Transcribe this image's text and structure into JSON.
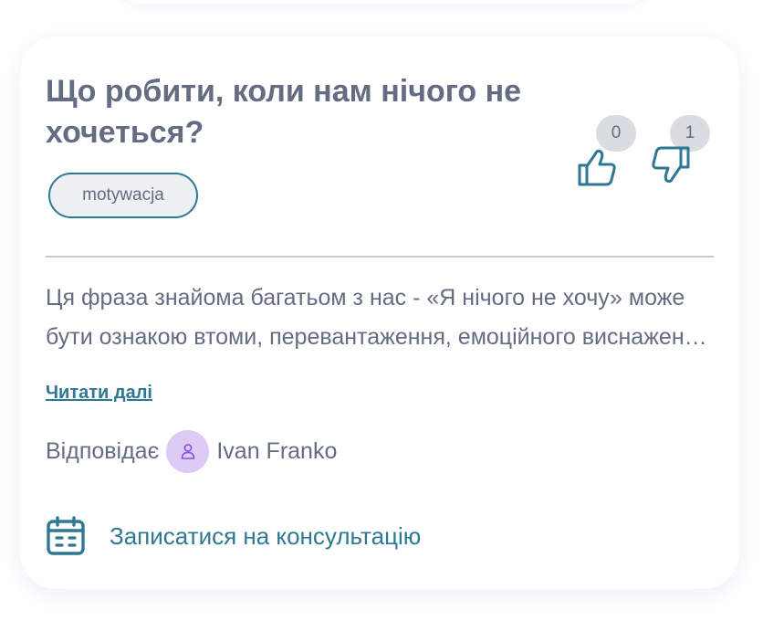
{
  "card": {
    "title": "Що робити, коли нам нічого не хочеться?",
    "tag": "motywacja",
    "likes": "0",
    "dislikes": "1",
    "excerpt": "Ця фраза знайома багатьом з нас - «Я нічого не хочу» може бути ознакою втоми, перевантаження, емоційного виснаження або навіть депресії.",
    "read_more": "Читати далі",
    "answer_prefix": "Відповідає",
    "author": "Ivan Franko",
    "consult_label": "Записатися на консультацію"
  },
  "icons": {
    "like": "thumbs-up-icon",
    "dislike": "thumbs-down-icon",
    "avatar": "user-icon",
    "consult": "calendar-icon"
  },
  "colors": {
    "text": "#636c82",
    "accent": "#2f7893",
    "badge_bg": "#d9dde1",
    "avatar_bg": "#dcccf5",
    "avatar_icon": "#8a4fe0"
  }
}
